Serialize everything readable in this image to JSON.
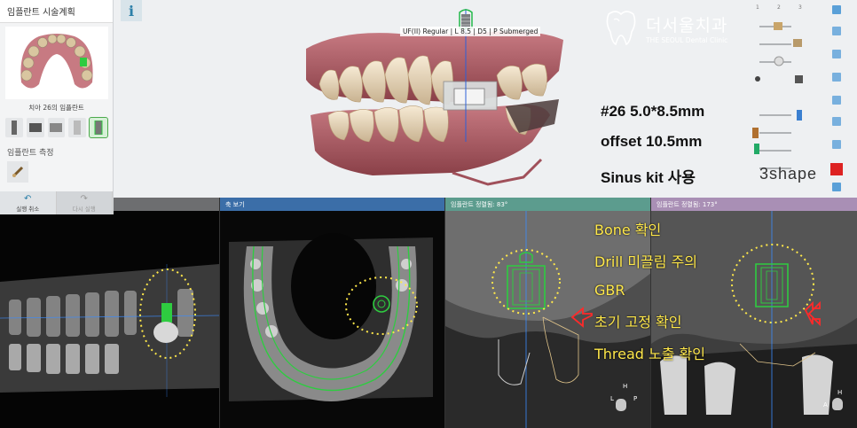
{
  "left_panel": {
    "title": "임플란트 시술계획",
    "info": "i",
    "thumb_caption": "치아 26의 임플란트",
    "measure_label": "임플란트 측정",
    "undo": "실행 취소",
    "redo": "다시 실행"
  },
  "scene": {
    "implant_label": "UF(II) Regular | L 8.5 | D5 | P Submerged"
  },
  "logo": {
    "name": "더서울치과",
    "sub": "THE SEOUL Dental Clinic"
  },
  "notes": {
    "line1": "#26  5.0*8.5mm",
    "line2": "offset 10.5mm",
    "line3": "Sinus kit 사용"
  },
  "brand": "3shape",
  "right_tools": {
    "column_numbers": [
      "1",
      "2",
      "3"
    ]
  },
  "ct": {
    "panel1_title": "",
    "panel2_title": "축 보기",
    "panel3_title": "임플란트 정렬됨: 83°",
    "panel4_title": "임플란트 정렬됨: 173°"
  },
  "orientation": {
    "p1": [
      "P",
      "R",
      "L",
      "A"
    ],
    "p3": [
      "H",
      "L",
      "P"
    ],
    "p4": [
      "H",
      "A"
    ]
  },
  "annotations": {
    "a1": "Bone 확인",
    "a2": "Drill 미끌림 주의",
    "a3": "GBR",
    "a4": "초기 고정 확인",
    "a5": "Thread 노출 확인"
  },
  "colors": {
    "annotation": "#ffe84a",
    "implant": "#2ecc40",
    "panel2_header": "#3b6ea8",
    "panel3_header": "#5c9c8e",
    "panel4_header": "#a98fb5"
  }
}
